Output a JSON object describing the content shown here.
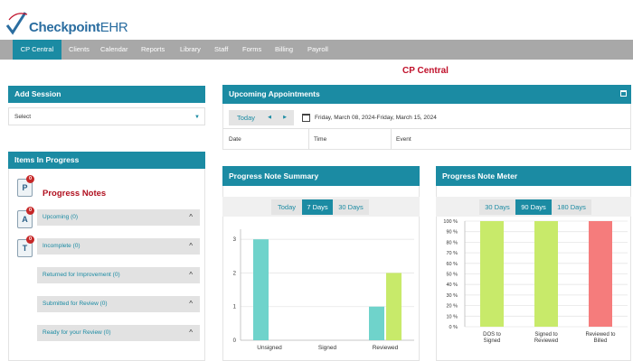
{
  "app": {
    "logo_main": "Checkpoint",
    "logo_suffix": "EHR"
  },
  "nav": {
    "items": [
      "CP Central",
      "Clients",
      "Calendar",
      "Reports",
      "Library",
      "Staff",
      "Forms",
      "Billing",
      "Payroll"
    ],
    "active_index": 0
  },
  "page_title": "CP Central",
  "add_session": {
    "title": "Add Session",
    "select_value": "Select"
  },
  "items_in_progress": {
    "title": "Items In Progress",
    "section_title": "Progress Notes",
    "icons": [
      {
        "letter": "P",
        "badge": "0"
      },
      {
        "letter": "A",
        "badge": "0"
      },
      {
        "letter": "T",
        "badge": "0"
      }
    ],
    "rows": [
      "Upcoming (0)",
      "Incomplete (0)",
      "Returned for Improvement (0)",
      "Submitted for Review (0)",
      "Ready for your Review (0)"
    ]
  },
  "appointments": {
    "title": "Upcoming Appointments",
    "today_label": "Today",
    "prev_label": "◀",
    "next_label": "▶",
    "date_range": "Friday, March 08, 2024-Friday, March 15, 2024",
    "columns": [
      "Date",
      "Time",
      "Event"
    ]
  },
  "summary": {
    "title": "Progress Note Summary",
    "tabs": [
      "Today",
      "7 Days",
      "30 Days"
    ],
    "active_tab": 1
  },
  "meter": {
    "title": "Progress Note Meter",
    "tabs": [
      "30 Days",
      "90 Days",
      "180 Days"
    ],
    "active_tab": 1
  },
  "chart_data": [
    {
      "type": "bar",
      "categories": [
        "Unsigned",
        "Signed",
        "Reviewed"
      ],
      "series": [
        {
          "values": [
            3,
            0,
            1
          ],
          "color": "#6fd3cb"
        },
        {
          "values": [
            0,
            0,
            2
          ],
          "color": "#c8ea6a"
        }
      ],
      "yticks": [
        "0",
        "1",
        "2",
        "3"
      ],
      "ylim": [
        0,
        3.3
      ]
    },
    {
      "type": "bar",
      "categories": [
        "DOS to Signed",
        "Signed to Reviewed",
        "Reviewed to Billed"
      ],
      "values": [
        100,
        100,
        100
      ],
      "colors": [
        "#c8ea6a",
        "#c8ea6a",
        "#f57c7c"
      ],
      "yticks": [
        "0 %",
        "10 %",
        "20 %",
        "30 %",
        "40 %",
        "50 %",
        "60 %",
        "70 %",
        "80 %",
        "90 %",
        "100 %"
      ],
      "ylim": [
        0,
        100
      ]
    }
  ]
}
